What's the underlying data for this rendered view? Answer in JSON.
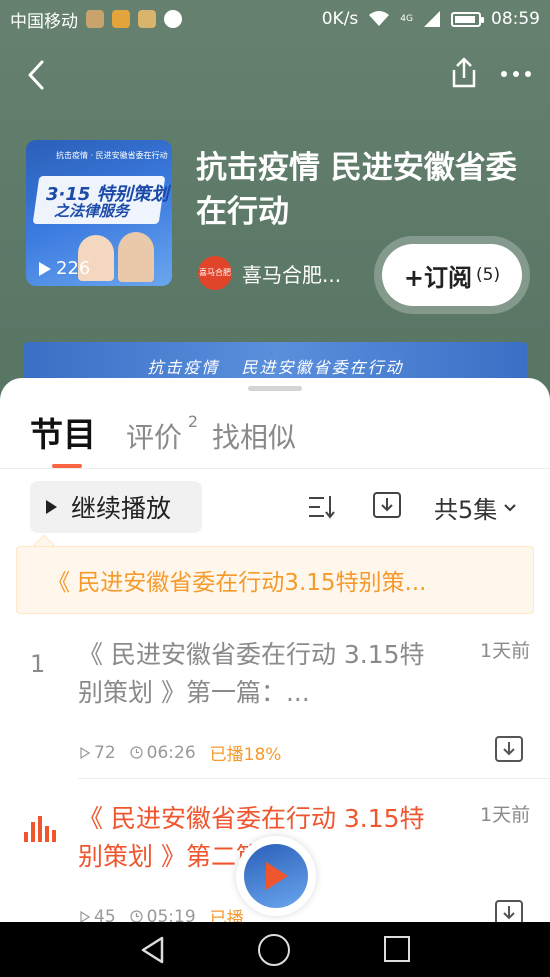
{
  "status_bar": {
    "carrier": "中国移动",
    "net_speed": "0K/s",
    "net_type": "4G",
    "time": "08:59"
  },
  "header": {
    "back_icon": "chevron-left-icon",
    "share_icon": "share-icon",
    "more_icon": "more-dots-icon"
  },
  "album": {
    "cover_top_text": "抗击疫情 · 民进安徽省委在行动",
    "cover_line1": "3·15 特别策划",
    "cover_line2": "之法律服务",
    "play_count": "226",
    "title": "抗击疫情 民进安徽省委在行动",
    "author_avatar_text": "喜马合肥",
    "author_name": "喜马合肥...",
    "subscribe_label": "+订阅",
    "subscribe_count": "(5)"
  },
  "banner": {
    "left": "抗击疫情",
    "right": "民进安徽省委在行动"
  },
  "tabs": [
    {
      "label": "节目"
    },
    {
      "label": "评价",
      "badge": "2"
    },
    {
      "label": "找相似"
    }
  ],
  "toolbar": {
    "continue_label": "继续播放",
    "count_label": "共5集"
  },
  "resume_tip": "《 民进安徽省委在行动3.15特别策...",
  "episodes": [
    {
      "index": "1",
      "title": "《 民进安徽省委在行动 3.15特别策划 》第一篇：...",
      "date": "1天前",
      "plays": "72",
      "duration": "06:26",
      "progress": "已播18%"
    },
    {
      "index": "",
      "title": "《 民进安徽省委在行动 3.15特别策划 》第二篇：...",
      "date": "1天前",
      "plays": "45",
      "duration": "05:19",
      "progress": "已播"
    }
  ],
  "colors": {
    "accent": "#f0562e",
    "tip": "#f59a2c",
    "header_bg": "#5f7a6a"
  }
}
